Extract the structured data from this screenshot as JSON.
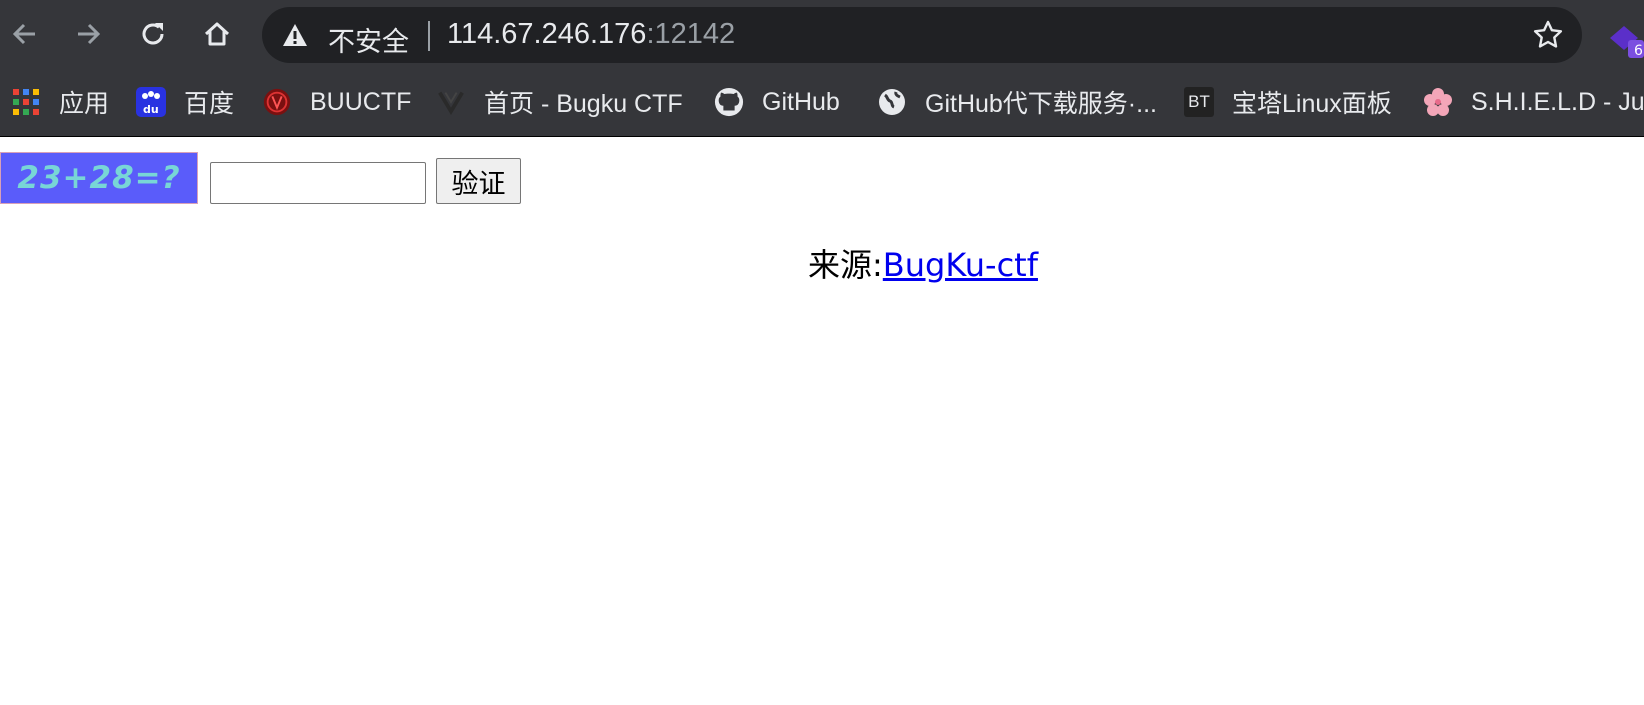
{
  "toolbar": {
    "security_label": "不安全",
    "url_host": "114.67.246.176",
    "url_port": ":12142"
  },
  "bookmarks": [
    {
      "label": "应用",
      "icon": "apps-grid-icon"
    },
    {
      "label": "百度",
      "icon": "baidu-icon"
    },
    {
      "label": "BUUCTF",
      "icon": "buuctf-icon"
    },
    {
      "label": "首页 - Bugku CTF",
      "icon": "bugku-icon"
    },
    {
      "label": "GitHub",
      "icon": "github-icon"
    },
    {
      "label": "GitHub代下载服务·...",
      "icon": "globe-icon"
    },
    {
      "label": "宝塔Linux面板",
      "icon": "bt-icon"
    },
    {
      "label": "S.H.I.E.L.D - Jus",
      "icon": "flower-icon"
    }
  ],
  "bt_icon_text": "BT",
  "page": {
    "captcha_text": "23+28=?",
    "answer_value": "",
    "verify_label": "验证",
    "source_prefix": "来源:",
    "source_link": "BugKu-ctf"
  },
  "colors": {
    "toolbar_bg": "#35363a",
    "omnibox_bg": "#202124",
    "captcha_bg": "#5a5cfa",
    "captcha_text": "#78d6d6",
    "link": "#0000ee"
  }
}
